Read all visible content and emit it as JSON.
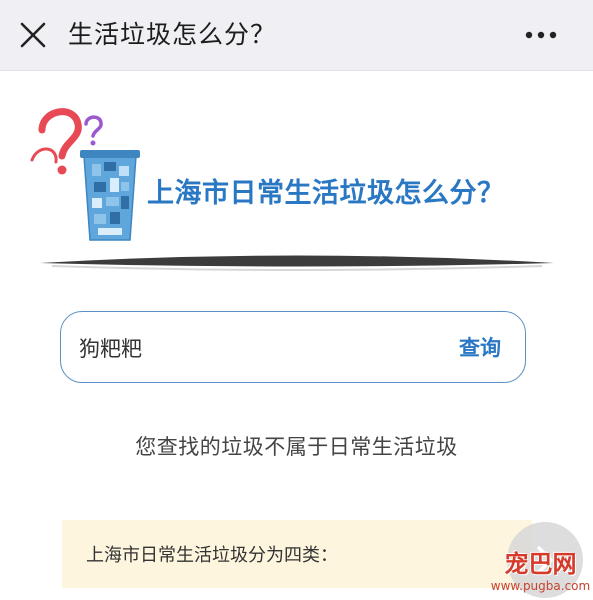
{
  "header": {
    "title": "生活垃圾怎么分？",
    "close_icon": "close-icon",
    "more_icon": "more-icon"
  },
  "banner": {
    "headline": "上海市日常生活垃圾怎么分？",
    "illustration_icon": "trash-bin-question-illustration",
    "colors": {
      "headline": "#2a78c4",
      "question_red": "#e84a55",
      "question_purple": "#9b59d0"
    }
  },
  "search": {
    "value": "狗粑粑",
    "button_label": "查询"
  },
  "result": {
    "message": "您查找的垃圾不属于日常生活垃圾"
  },
  "info": {
    "text": "上海市日常生活垃圾分为四类："
  },
  "scroll_button": {
    "icon": "chevron-right-icon"
  },
  "watermark": {
    "main": "宠巴网",
    "sub": "www.pugba.com"
  }
}
